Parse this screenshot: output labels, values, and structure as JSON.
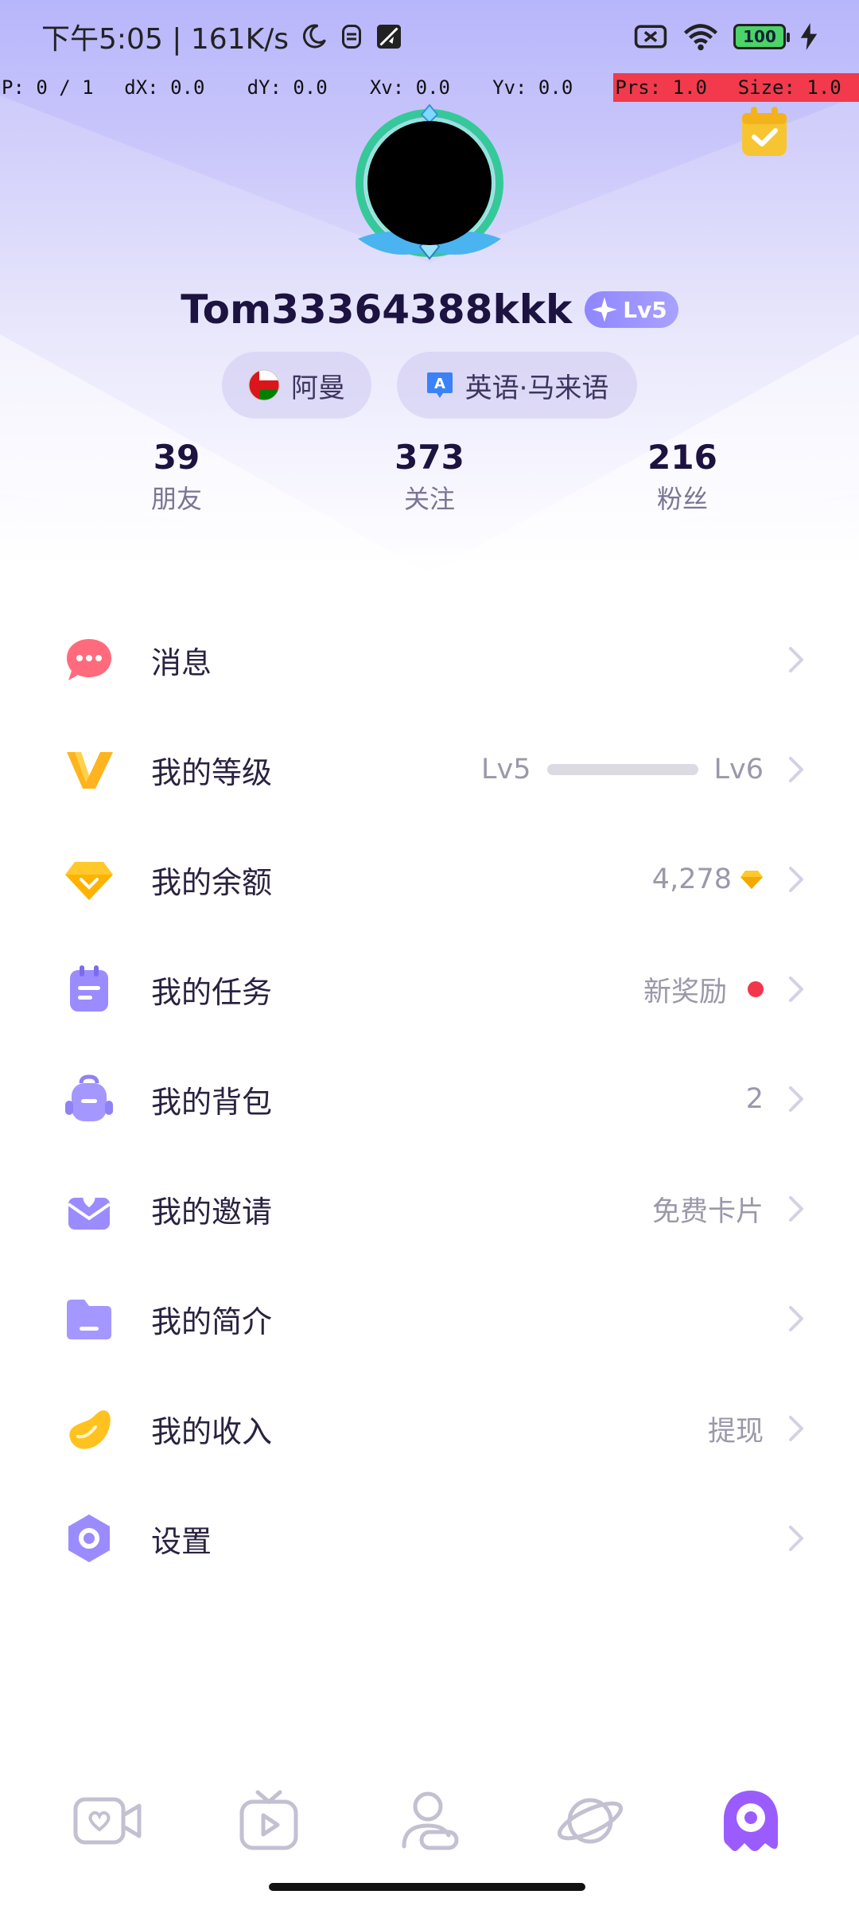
{
  "status_bar": {
    "time_text": "下午5:05 | 161K/s",
    "battery": "100"
  },
  "debug": {
    "pointers": "P: 0 / 1",
    "dx": "dX: 0.0",
    "dy": "dY: 0.0",
    "xv": "Xv: 0.0",
    "yv": "Yv: 0.0",
    "prs": "Prs: 1.0",
    "size": "Size: 1.0"
  },
  "profile": {
    "username": "Tom33364388kkk",
    "level_badge": "Lv5",
    "country": "阿曼",
    "languages": "英语·马来语"
  },
  "stats": [
    {
      "value": "39",
      "label": "朋友"
    },
    {
      "value": "373",
      "label": "关注"
    },
    {
      "value": "216",
      "label": "粉丝"
    }
  ],
  "menu": {
    "messages": {
      "label": "消息"
    },
    "level": {
      "label": "我的等级",
      "from": "Lv5",
      "to": "Lv6",
      "progress": 0.0
    },
    "balance": {
      "label": "我的余额",
      "value": "4,278"
    },
    "tasks": {
      "label": "我的任务",
      "value": "新奖励"
    },
    "backpack": {
      "label": "我的背包",
      "value": "2"
    },
    "invite": {
      "label": "我的邀请",
      "value": "免费卡片"
    },
    "profile": {
      "label": "我的简介"
    },
    "income": {
      "label": "我的收入",
      "value": "提现"
    },
    "settings": {
      "label": "设置"
    }
  },
  "bottom_nav": [
    "video-call-icon",
    "tv-icon",
    "friends-icon",
    "planet-icon",
    "profile-mascot-icon"
  ],
  "colors": {
    "accent": "#8f86ff",
    "hero_top": "#b8b6fb",
    "active_nav": "#9b5cff",
    "alert": "#f2364b"
  }
}
